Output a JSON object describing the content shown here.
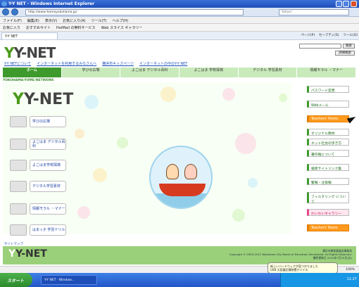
{
  "window": {
    "title": "Y-Y NET - Windows Internet Explorer",
    "url": "http://www-hamayokohama.jp/",
    "search_placeholder": "Yahoo!"
  },
  "menu": [
    "ファイル(F)",
    "編集(E)",
    "表示(V)",
    "お気に入り(A)",
    "ツール(T)",
    "ヘルプ(H)"
  ],
  "favorites": [
    "お気に入り",
    "おすすめサイト",
    "HotMail の無料サービス",
    "Web スライス ギャラリー"
  ],
  "tab_label": "Y-Y NET",
  "commands": [
    "ページ(P)",
    "セーフティ(S)",
    "ツール(O)"
  ],
  "site": {
    "logo": "Y-NET",
    "search_button": "検索",
    "detail_button": "詳細検索",
    "top_links": [
      "Y-Y NETについて",
      "インターネットを利用するみなさんへ",
      "横浜市キッズページ",
      "インターネットの中のY-Y NET"
    ],
    "gnav": [
      "ホーム",
      "学びの広場",
      "よこはま デジタル百科",
      "よこはま 学校探検",
      "デジタル 学習素材",
      "情報モラル ・マナー"
    ],
    "banner": "YOKOHAMA-YUME-NETWORK",
    "left_menu": [
      "学びの広場",
      "よこはま デジタル百科",
      "よこはま学校探検",
      "デジタル学習素材",
      "情報モラル ・マナー",
      "はまっ子 学習ドリル"
    ],
    "right_menu": [
      "パスワード変更",
      "Webメール",
      "Teachers' Home",
      "オリジナル教材",
      "ネット社会の歩き方",
      "著作権について",
      "検索サイトリンク集",
      "警報・注意報",
      "フィルタリング について",
      "わいわいギャラリー",
      "Teachers' Room"
    ],
    "sitemap": "サイトマップ",
    "footer_logo": "Y-NET",
    "org": "横浜市教育委員会事務局",
    "copyright": "Copyright © 2000-2012 Yokohama City Board of Education Secretariat. All Rights Reserved.",
    "updated": "最終更新日 2012年7月25日(水)"
  },
  "status": {
    "zoom": "100%"
  },
  "taskbar": {
    "start": "スタート",
    "task_button": "Y-Y NET - Window...",
    "clock": "11:27"
  },
  "balloon": {
    "title": "新しいハードウェアが見つかりました",
    "text": "USB 大容量記憶装置デバイス"
  }
}
